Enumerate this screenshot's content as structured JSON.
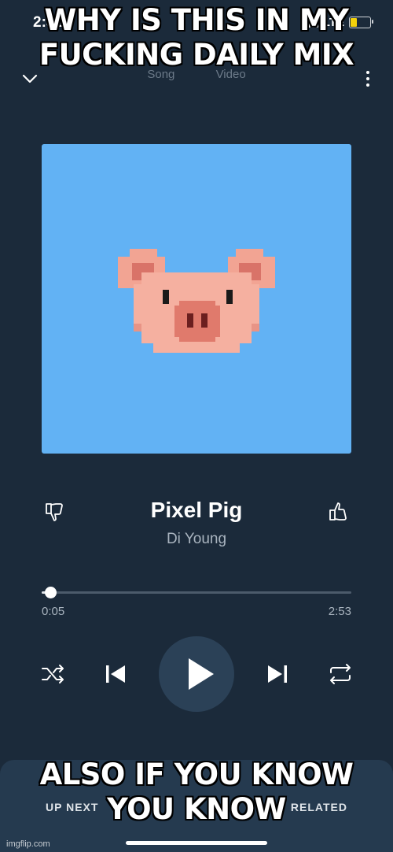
{
  "status_bar": {
    "time": "2:31",
    "network": "LTE"
  },
  "header": {
    "tabs": [
      "Song",
      "Video"
    ],
    "collapse_icon": "chevron-down-icon",
    "menu_icon": "more-vertical-icon"
  },
  "meme": {
    "top_text": "WHY IS THIS IN MY FUCKING DAILY MIX",
    "bottom_text": "ALSO IF YOU KNOW YOU KNOW"
  },
  "album_art": {
    "background": "#62b2f4",
    "subject": "pixel-pig"
  },
  "song": {
    "title": "Pixel Pig",
    "artist": "Di Young"
  },
  "progress": {
    "elapsed": "0:05",
    "duration": "2:53",
    "fraction": 0.03
  },
  "controls": [
    "shuffle-icon",
    "skip-previous-icon",
    "play-icon",
    "skip-next-icon",
    "repeat-icon"
  ],
  "bottom_panel": {
    "left_label": "UP NEXT",
    "right_label": "RELATED"
  },
  "watermark": "imgflip.com"
}
